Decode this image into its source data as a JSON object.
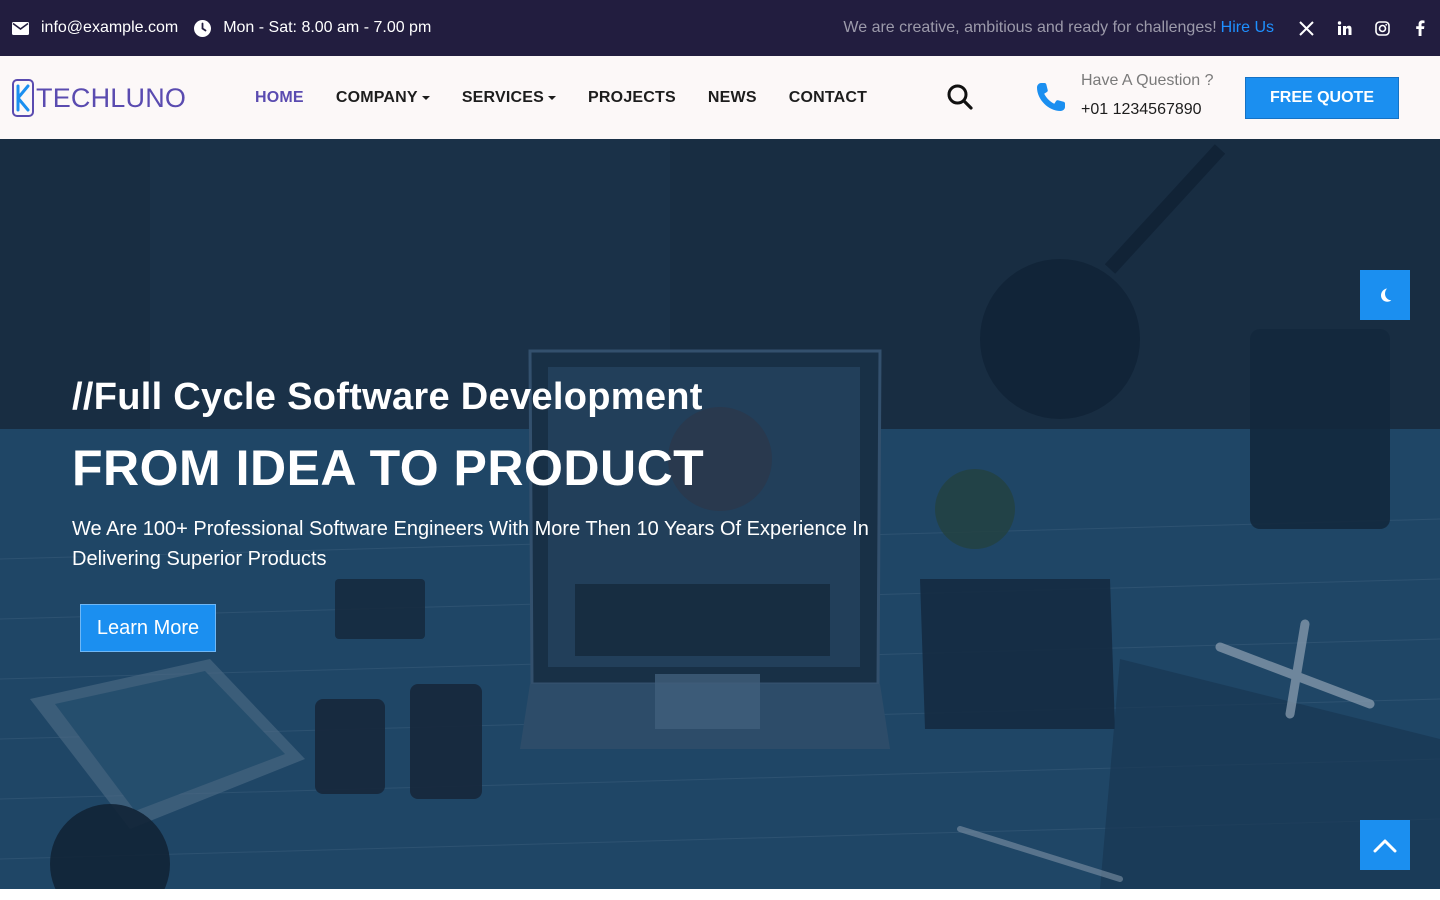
{
  "topbar": {
    "email": "info@example.com",
    "hours": "Mon - Sat: 8.00 am - 7.00 pm",
    "tagline": "We are creative, ambitious and ready for challenges!",
    "hire_link": "Hire Us",
    "social": [
      "x-icon",
      "linkedin-icon",
      "instagram-icon",
      "facebook-icon"
    ]
  },
  "header": {
    "logo_text": "TECHLUNO",
    "nav": [
      {
        "label": "HOME",
        "active": true
      },
      {
        "label": "COMPANY",
        "dropdown": true
      },
      {
        "label": "SERVICES",
        "dropdown": true
      },
      {
        "label": "PROJECTS"
      },
      {
        "label": "NEWS"
      },
      {
        "label": "CONTACT"
      }
    ],
    "question_label": "Have A Question ?",
    "phone": "+01 1234567890",
    "quote_button": "FREE QUOTE"
  },
  "hero": {
    "subtitle": "//Full Cycle Software Development",
    "title": "FROM IDEA TO PRODUCT",
    "description": "We Are 100+ Professional Software Engineers With More Then 10 Years Of Experience In Delivering Superior Products",
    "cta": "Learn More"
  },
  "colors": {
    "topbar_bg": "#221d3f",
    "accent_blue": "#1b8ff0",
    "brand_purple": "#5a4bb0",
    "header_bg": "#fcf8f8"
  }
}
